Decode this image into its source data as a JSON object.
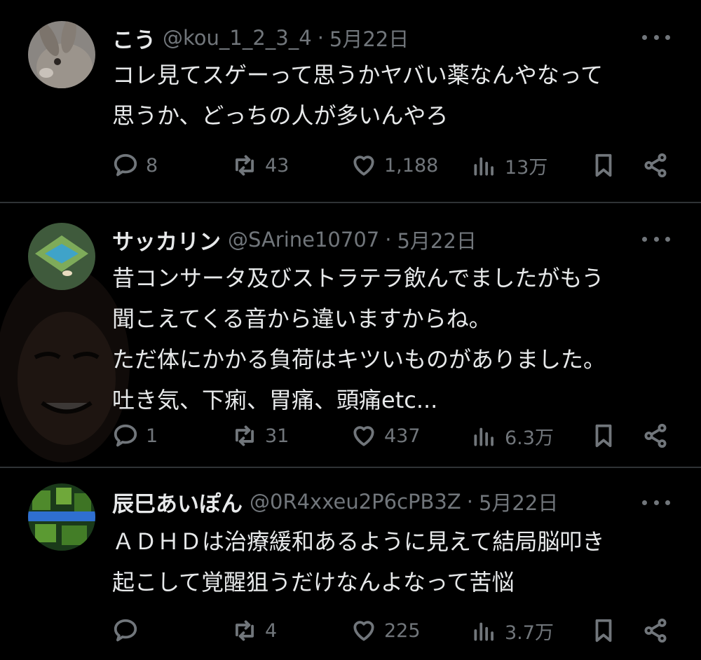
{
  "tweets": [
    {
      "name": "こう",
      "handle": "@kou_1_2_3_4",
      "separator": "·",
      "date": "5月22日",
      "text": "コレ見てスゲーって思うかヤバい薬なんやなって\n思うか、どっちの人が多いんやろ",
      "replies": "8",
      "retweets": "43",
      "likes": "1,188",
      "views": "13万"
    },
    {
      "name": "サッカリン",
      "handle": "@SArine10707",
      "separator": "·",
      "date": "5月22日",
      "text": "昔コンサータ及びストラテラ飲んでましたがもう\n聞こえてくる音から違いますからね。\nただ体にかかる負荷はキツいものがありました。\n吐き気、下痢、胃痛、頭痛etc...",
      "replies": "1",
      "retweets": "31",
      "likes": "437",
      "views": "6.3万"
    },
    {
      "name": "辰巳あいぽん",
      "handle": "@0R4xxeu2P6cPB3Z",
      "separator": "·",
      "date": "5月22日",
      "text": "ＡＤＨＤは治療緩和あるように見えて結局脳叩き\n起こして覚醒狙うだけなんよなって苦悩",
      "replies": "",
      "retweets": "4",
      "likes": "225",
      "views": "3.7万"
    }
  ],
  "colors": {
    "background": "#000000",
    "text": "#e7e9ea",
    "muted": "#71767b",
    "divider": "#2f3336"
  },
  "icons": [
    "reply-icon",
    "retweet-icon",
    "like-icon",
    "views-icon",
    "bookmark-icon",
    "share-icon",
    "more-icon"
  ]
}
